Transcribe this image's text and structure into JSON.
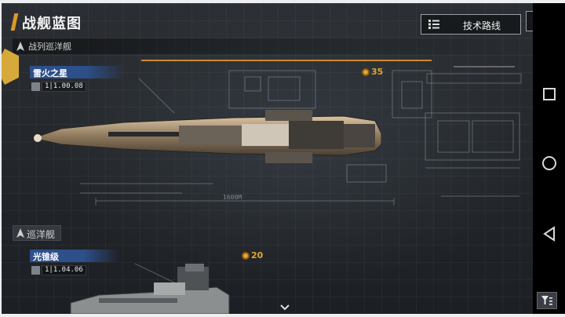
{
  "header": {
    "title": "战舰蓝图",
    "tech_route_label": "技术路线"
  },
  "categories": [
    {
      "label": "战列巡洋舰"
    },
    {
      "label": "巡洋舰"
    }
  ],
  "ships": [
    {
      "name": "雷火之星",
      "stat": "1|1.00.08",
      "cost": "35"
    },
    {
      "name": "光锥级",
      "stat": "1|1.04.06",
      "cost": "20"
    }
  ],
  "blueprint_labels": {
    "length": "1600M"
  },
  "icons": {
    "close": "close-icon",
    "tech": "list-icon",
    "scroll": "chevron-down-icon",
    "filter": "filter-icon",
    "nav_recent": "square-icon",
    "nav_home": "circle-icon",
    "nav_back": "triangle-back-icon"
  },
  "colors": {
    "accent": "#d99a2b",
    "name_bar": "#2d4f8a",
    "cost": "#e3a430"
  }
}
